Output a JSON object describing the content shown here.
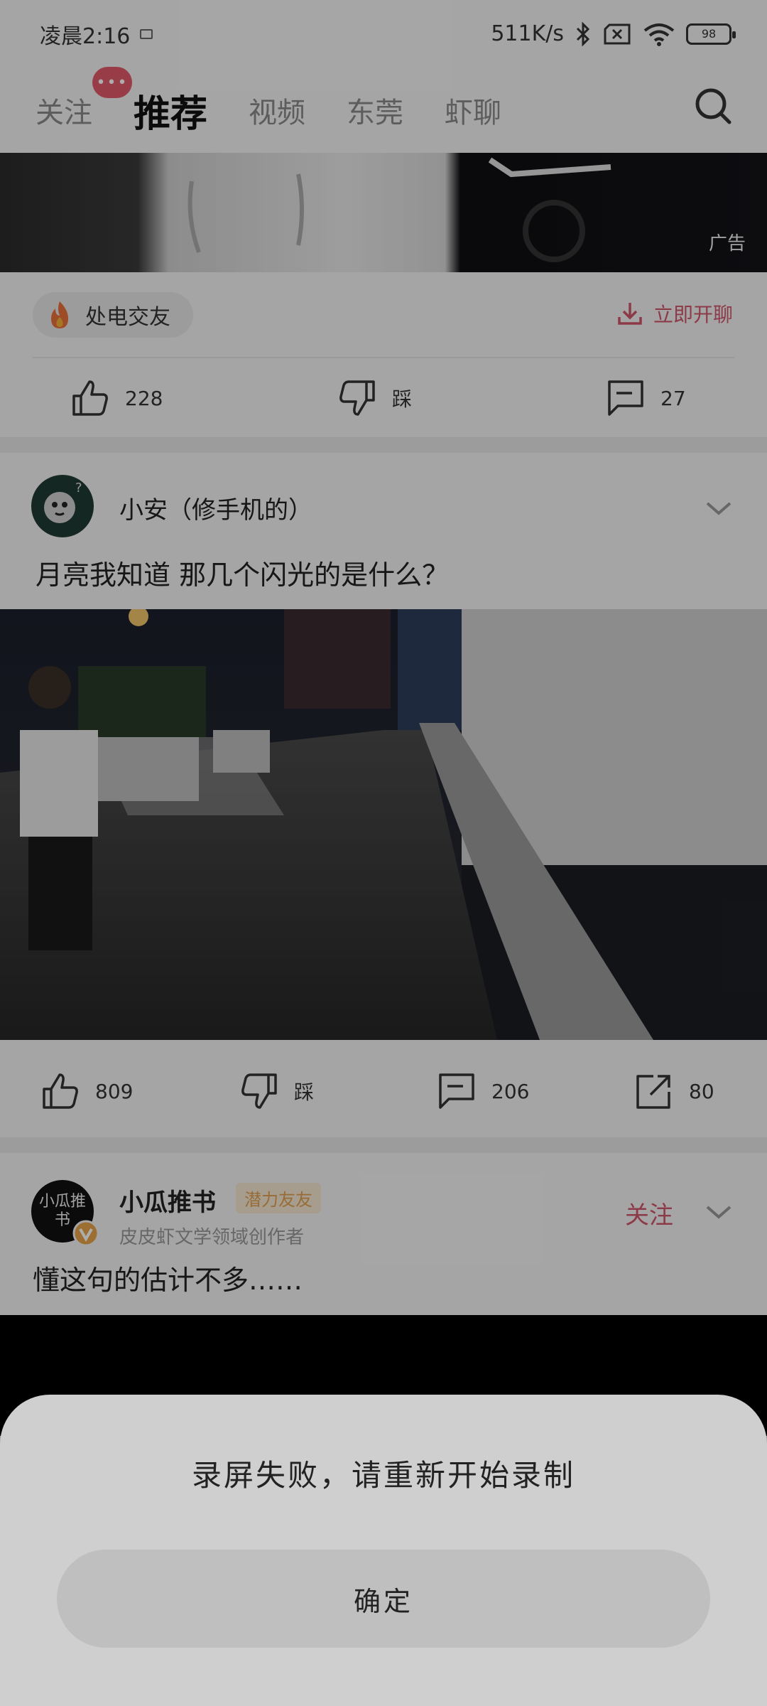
{
  "status_bar": {
    "time": "凌晨2:16",
    "net_speed": "511K/s",
    "battery": "98"
  },
  "tabs": [
    {
      "label": "关注",
      "badge": "•••"
    },
    {
      "label": "推荐"
    },
    {
      "label": "视频"
    },
    {
      "label": "东莞"
    },
    {
      "label": "虾聊"
    }
  ],
  "ad": {
    "label": "广告",
    "chip_text": "处电交友",
    "action_text": "立即开聊",
    "likes": "228",
    "dislike_label": "踩",
    "comments": "27"
  },
  "post1": {
    "author": "小安（修手机的）",
    "text": "月亮我知道 那几个闪光的是什么？",
    "likes": "809",
    "dislike_label": "踩",
    "comments": "206",
    "shares": "80"
  },
  "post2": {
    "author": "小瓜推书",
    "avatar_text": "小瓜推书",
    "tag": "潜力友友",
    "subtitle": "皮皮虾文学领域创作者",
    "follow_label": "关注",
    "text": "懂这句的估计不多……"
  },
  "dialog": {
    "message": "录屏失败，请重新开始录制",
    "confirm_label": "确定"
  },
  "colors": {
    "accent": "#e05a6a",
    "dialog_bg": "#cfcfcf",
    "button_bg": "#bfbfbf"
  }
}
